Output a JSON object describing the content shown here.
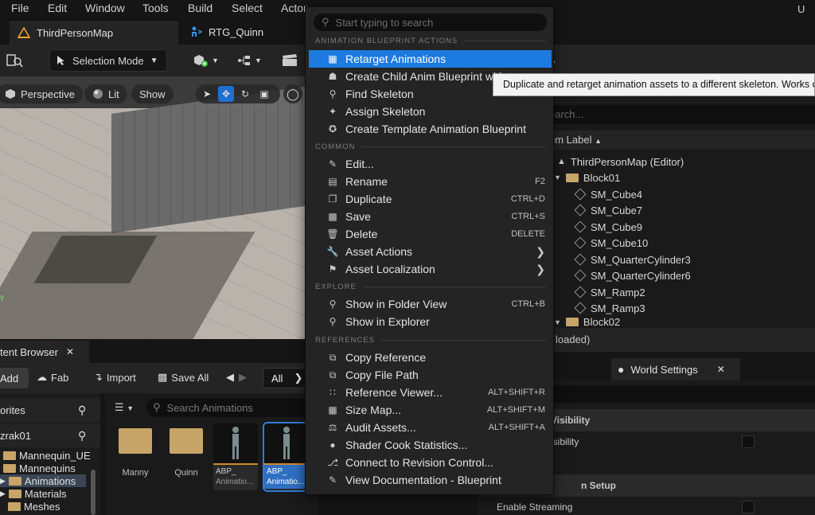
{
  "menubar": {
    "items": [
      "File",
      "Edit",
      "Window",
      "Tools",
      "Build",
      "Select",
      "Actor"
    ],
    "right_glyph": "U"
  },
  "tabs": [
    {
      "label": "ThirdPersonMap",
      "icon": "level-icon"
    },
    {
      "label": "RTG_Quinn",
      "icon": "retarget-icon"
    }
  ],
  "toolbar": {
    "selection_mode": "Selection Mode"
  },
  "viewport": {
    "perspective": "Perspective",
    "lit": "Lit",
    "show": "Show"
  },
  "content_browser": {
    "tab_label": "tent Browser",
    "add": "Add",
    "fab": "Fab",
    "import": "Import",
    "save_all": "Save All",
    "filter": "All",
    "favorites": "orites",
    "project": "zrak01",
    "tree": [
      "Mannequin_UE",
      "Mannequins",
      "Animations",
      "Materials",
      "Meshes"
    ],
    "search_placeholder": "Search Animations",
    "assets": [
      {
        "name": "Manny",
        "kind": "folder"
      },
      {
        "name": "Quinn",
        "kind": "folder"
      },
      {
        "name": "ABP_",
        "sub": "Animatio...",
        "kind": "anim-bp"
      },
      {
        "name": "ABP_",
        "sub": "Animatio...",
        "kind": "anim-bp",
        "selected": true
      }
    ]
  },
  "context_menu": {
    "search_placeholder": "Start typing to search",
    "sections": {
      "anim_bp": "ANIMATION BLUEPRINT ACTIONS",
      "common": "COMMON",
      "explore": "EXPLORE",
      "references": "REFERENCES"
    },
    "anim_items": [
      {
        "label": "Retarget Animations",
        "icon": "retarget-icon",
        "highlighted": true
      },
      {
        "label": "Create Child Anim Blueprint with",
        "icon": "child-blueprint-icon"
      },
      {
        "label": "Find Skeleton",
        "icon": "find-icon"
      },
      {
        "label": "Assign Skeleton",
        "icon": "skeleton-icon"
      },
      {
        "label": "Create Template Animation Blueprint",
        "icon": "template-icon"
      }
    ],
    "common_items": [
      {
        "label": "Edit...",
        "icon": "pencil-icon",
        "shortcut": ""
      },
      {
        "label": "Rename",
        "icon": "rename-icon",
        "shortcut": "F2"
      },
      {
        "label": "Duplicate",
        "icon": "duplicate-icon",
        "shortcut": "CTRL+D"
      },
      {
        "label": "Save",
        "icon": "save-icon",
        "shortcut": "CTRL+S"
      },
      {
        "label": "Delete",
        "icon": "trash-icon",
        "shortcut": "DELETE"
      },
      {
        "label": "Asset Actions",
        "icon": "wrench-icon",
        "submenu": true
      },
      {
        "label": "Asset Localization",
        "icon": "flag-icon",
        "submenu": true
      }
    ],
    "explore_items": [
      {
        "label": "Show in Folder View",
        "icon": "folder-view-icon",
        "shortcut": "CTRL+B"
      },
      {
        "label": "Show in Explorer",
        "icon": "explorer-icon",
        "shortcut": ""
      }
    ],
    "reference_items": [
      {
        "label": "Copy Reference",
        "icon": "copy-icon",
        "shortcut": ""
      },
      {
        "label": "Copy File Path",
        "icon": "copy-path-icon",
        "shortcut": ""
      },
      {
        "label": "Reference Viewer...",
        "icon": "graph-icon",
        "shortcut": "ALT+SHIFT+R"
      },
      {
        "label": "Size Map...",
        "icon": "size-map-icon",
        "shortcut": "ALT+SHIFT+M"
      },
      {
        "label": "Audit Assets...",
        "icon": "audit-icon",
        "shortcut": "ALT+SHIFT+A"
      },
      {
        "label": "Shader Cook Statistics...",
        "icon": "shader-icon",
        "shortcut": ""
      },
      {
        "label": "Connect to Revision Control...",
        "icon": "revision-icon",
        "shortcut": ""
      },
      {
        "label": "View Documentation - Blueprint",
        "icon": "book-icon",
        "shortcut": ""
      }
    ]
  },
  "tooltip": "Duplicate and retarget animation assets to a different skeleton. Works on",
  "outliner": {
    "search_placeholder": "earch...",
    "column": "em Label",
    "rows": [
      {
        "label": "ThirdPersonMap (Editor)",
        "kind": "level"
      },
      {
        "label": "Block01",
        "kind": "folder"
      },
      {
        "label": "SM_Cube4",
        "kind": "mesh"
      },
      {
        "label": "SM_Cube7",
        "kind": "mesh"
      },
      {
        "label": "SM_Cube9",
        "kind": "mesh"
      },
      {
        "label": "SM_Cube10",
        "kind": "mesh"
      },
      {
        "label": "SM_QuarterCylinder3",
        "kind": "mesh"
      },
      {
        "label": "SM_QuarterCylinder6",
        "kind": "mesh"
      },
      {
        "label": "SM_Ramp2",
        "kind": "mesh"
      },
      {
        "label": "SM_Ramp3",
        "kind": "mesh"
      },
      {
        "label": "Block02",
        "kind": "folder"
      }
    ],
    "status": "loaded)"
  },
  "world_settings": {
    "tab": "World Settings",
    "section1": "Visibility",
    "row1": "isibility",
    "section2": "n Setup",
    "row2": "Enable Streaming"
  }
}
